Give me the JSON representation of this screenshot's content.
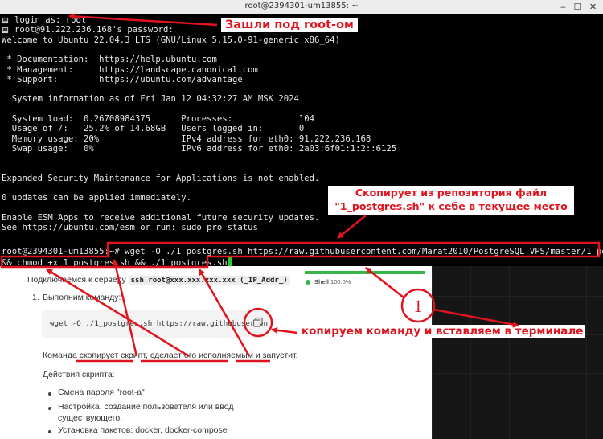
{
  "window": {
    "title": "root@2394301-um13855: ~",
    "minimize": "‒",
    "maximize": "☐",
    "close": "✕"
  },
  "terminal": {
    "lines": [
      "login as: root",
      "root@91.222.236.168's password:",
      "Welcome to Ubuntu 22.04.3 LTS (GNU/Linux 5.15.0-91-generic x86_64)",
      "",
      " * Documentation:  https://help.ubuntu.com",
      " * Management:     https://landscape.canonical.com",
      " * Support:        https://ubuntu.com/advantage",
      "",
      "  System information as of Fri Jan 12 04:32:27 AM MSK 2024",
      "",
      "  System load:  0.26708984375      Processes:             104",
      "  Usage of /:   25.2% of 14.68GB   Users logged in:       0",
      "  Memory usage: 20%                IPv4 address for eth0: 91.222.236.168",
      "  Swap usage:   0%                 IPv6 address for eth0: 2a03:6f01:1:2::6125",
      "",
      "",
      "Expanded Security Maintenance for Applications is not enabled.",
      "",
      "0 updates can be applied immediately.",
      "",
      "Enable ESM Apps to receive additional future security updates.",
      "See https://ubuntu.com/esm or run: sudo pro status",
      "",
      "",
      "root@2394301-um13855:~# wget -O ./1_postgres.sh https://raw.githubusercontent.com/Marat2010/PostgreSQL_VPS/master/1_postgres.sh",
      "&& chmod +x 1_postgres.sh && ./1_postgres.sh"
    ]
  },
  "annotations": {
    "login_note": "Зашли под root-ом",
    "copy_note_line1": "Скопирует из репозитория файл",
    "copy_note_line2": "\"1_postgres.sh\" к себе в текущее место",
    "paste_note": "копируем команду и вставляем в терминале",
    "step_marker": "1"
  },
  "doc": {
    "connect_text": "Подключаемся к серверу",
    "connect_code": "ssh root@xxx.xxx.xxx.xxx (_IP_Addr_)",
    "connect_tail": ".",
    "step1": "1.",
    "step1_text": "Выполним команду:",
    "code": "wget -O ./1_postgres.sh https://raw.githubusercontent.c",
    "explain": "Команда скопирует скрипт, сделает его исполняемым и запустит.",
    "actions_title": "Действия скрипта:",
    "bullets": [
      "Смена пароля \"root-а\"",
      "Настройка, создание пользователя или ввод",
      "существующего.",
      "Установка пакетов: docker, docker-compose"
    ]
  },
  "sidebar": {
    "shell_label": "Shell",
    "shell_percent": "100.0%",
    "progress": 1.0,
    "color": "#39b54a"
  },
  "colors": {
    "annotation": "#e0141e",
    "terminal_bg": "#000000",
    "cursor": "#2bd12b"
  }
}
